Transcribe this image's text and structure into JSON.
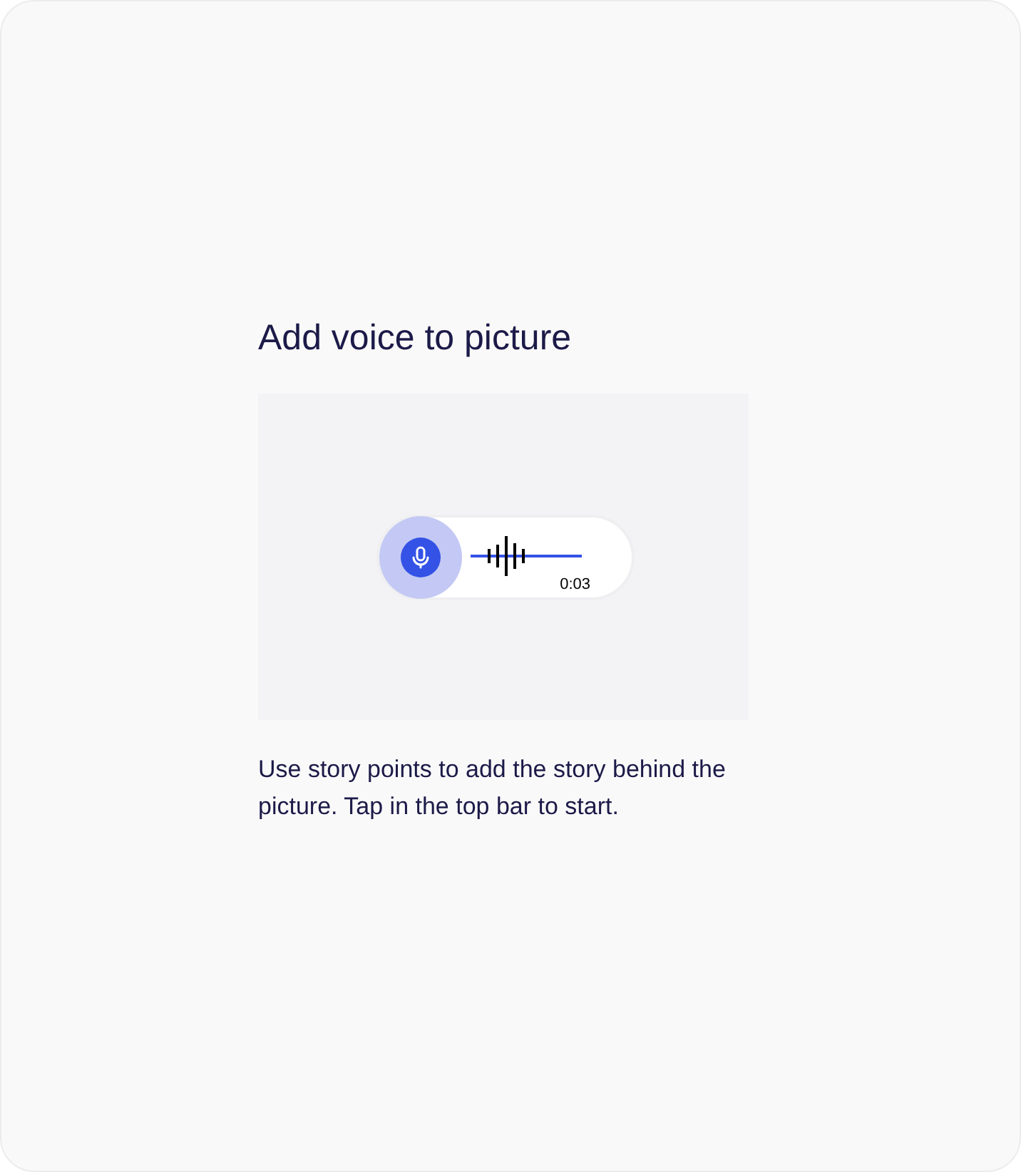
{
  "title": "Add voice to picture",
  "recorder": {
    "time": "0:03"
  },
  "description": "Use story points to add the story behind the picture. Tap in the top bar to start."
}
